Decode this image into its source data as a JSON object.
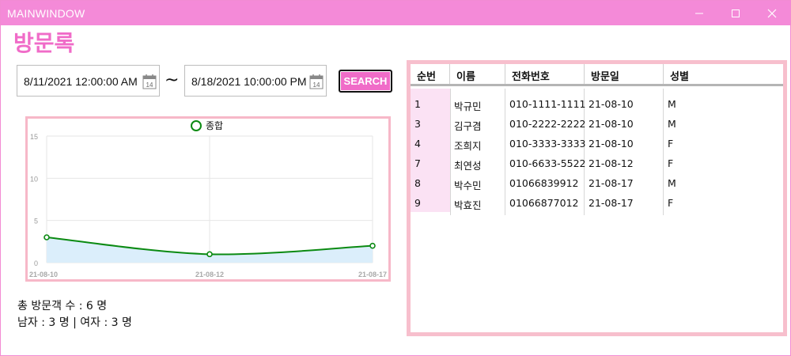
{
  "window": {
    "title": "MAINWINDOW",
    "accent": "#f48ad8"
  },
  "page": {
    "title": "방문록"
  },
  "filters": {
    "start_date": "8/11/2021 12:00:00 AM",
    "end_date": "8/18/2021 10:00:00 PM",
    "separator": "~",
    "calendar_day": "14",
    "search_label": "SEARCH"
  },
  "chart_data": {
    "type": "area",
    "legend": [
      "종합"
    ],
    "legend_position": "top-center",
    "categories": [
      "21-08-10",
      "21-08-12",
      "21-08-17"
    ],
    "series": [
      {
        "name": "종합",
        "values": [
          3,
          1,
          2
        ],
        "color": "#0b8a12",
        "fill": "#dbeefb"
      }
    ],
    "yticks": [
      "0",
      "5",
      "10",
      "15"
    ],
    "ylim": [
      0,
      15
    ],
    "grid": true
  },
  "summary": {
    "total_label": "총 방문객 수 : 6 명",
    "male_label": "남자 : 3 명",
    "divider": "|",
    "female_label": "여자 : 3 명"
  },
  "table": {
    "headers": [
      "순번",
      "이름",
      "전화번호",
      "방문일",
      "성별"
    ],
    "rows": [
      [
        "1",
        "박규민",
        "010-1111-1111",
        "21-08-10",
        "M"
      ],
      [
        "3",
        "김구겸",
        "010-2222-2222",
        "21-08-10",
        "M"
      ],
      [
        "4",
        "조희지",
        "010-3333-3333",
        "21-08-10",
        "F"
      ],
      [
        "7",
        "최연성",
        "010-6633-5522",
        "21-08-12",
        "F"
      ],
      [
        "8",
        "박수민",
        "01066839912",
        "21-08-17",
        "M"
      ],
      [
        "9",
        "박효진",
        "01066877012",
        "21-08-17",
        "F"
      ]
    ]
  }
}
